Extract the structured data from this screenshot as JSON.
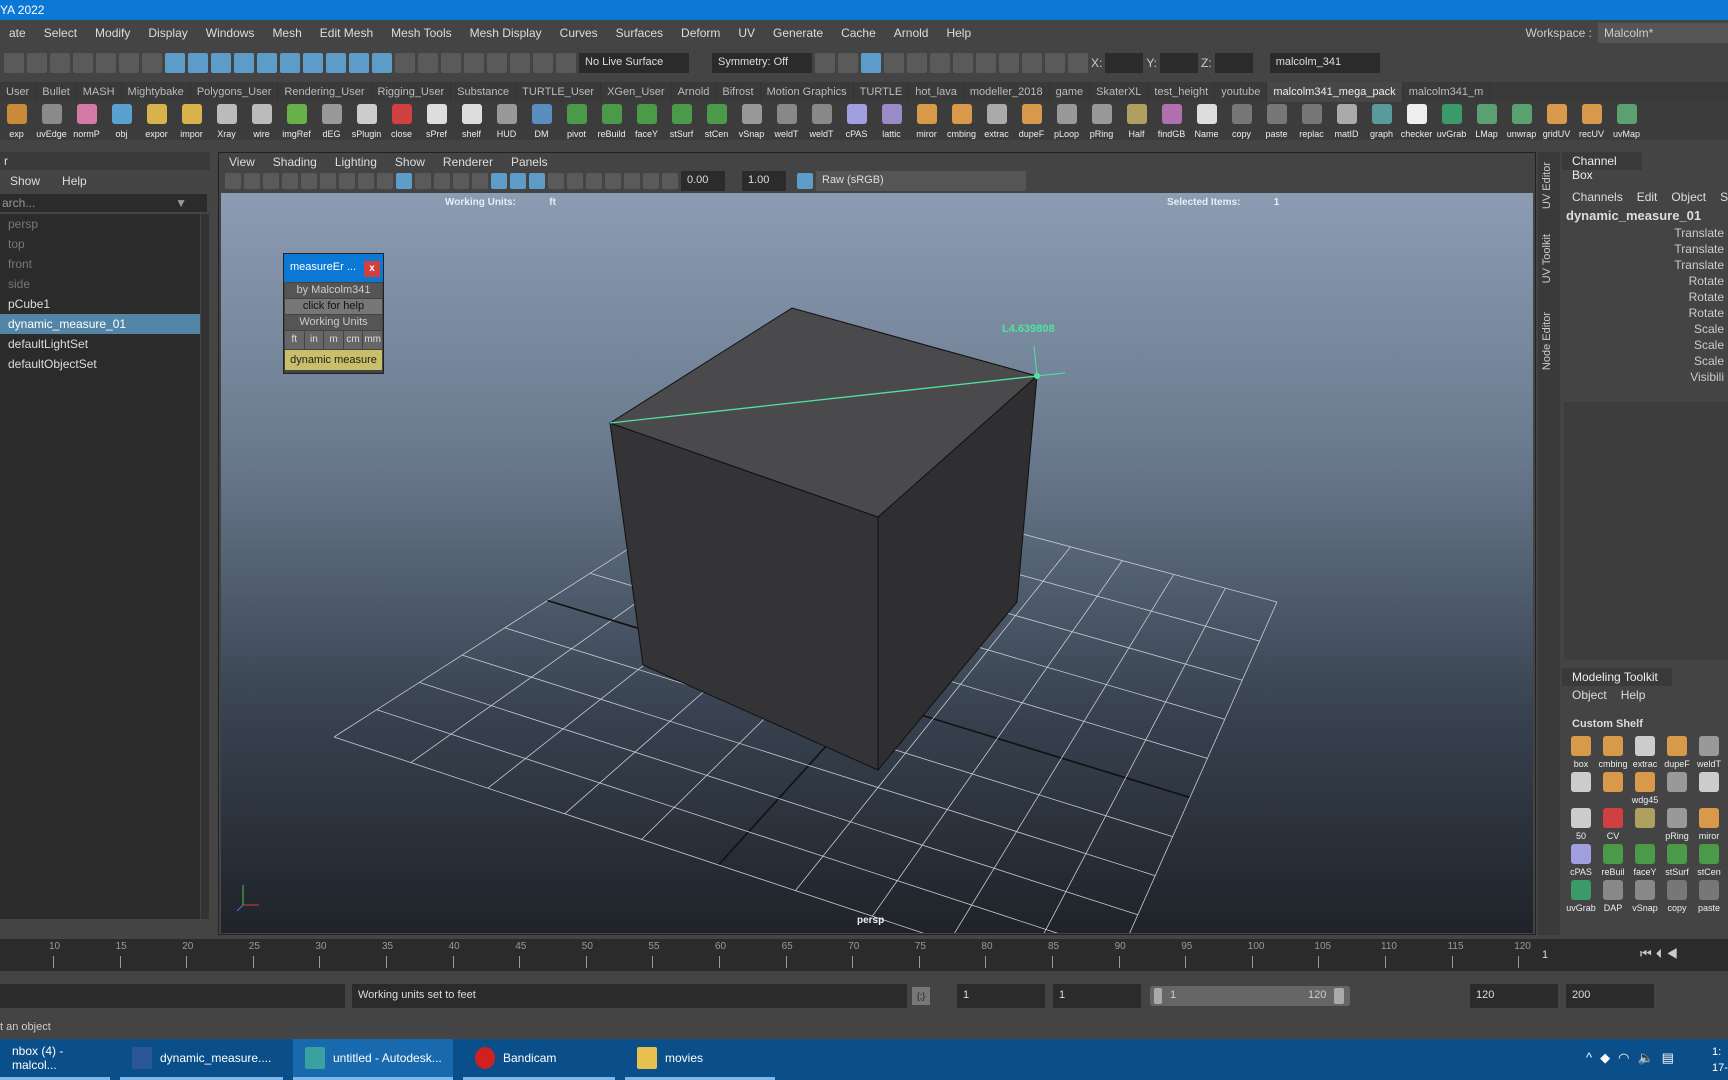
{
  "window": {
    "title": "YA 2022"
  },
  "menu": [
    "ate",
    "Select",
    "Modify",
    "Display",
    "Windows",
    "Mesh",
    "Edit Mesh",
    "Mesh Tools",
    "Mesh Display",
    "Curves",
    "Surfaces",
    "Deform",
    "UV",
    "Generate",
    "Cache",
    "Arnold",
    "Help"
  ],
  "workspace": {
    "label": "Workspace :",
    "value": "Malcolm*"
  },
  "statusline": {
    "live_surface": "No Live Surface",
    "symmetry": "Symmetry: Off",
    "x_label": "X:",
    "y_label": "Y:",
    "z_label": "Z:",
    "user": "malcolm_341"
  },
  "shelf_tabs": [
    "User",
    "Bullet",
    "MASH",
    "Mightybake",
    "Polygons_User",
    "Rendering_User",
    "Rigging_User",
    "Substance",
    "TURTLE_User",
    "XGen_User",
    "Arnold",
    "Bifrost",
    "Motion Graphics",
    "TURTLE",
    "hot_lava",
    "modeller_2018",
    "game",
    "SkaterXL",
    "test_height",
    "youtube",
    "malcolm341_mega_pack",
    "malcolm341_m"
  ],
  "active_shelf_tab": "malcolm341_mega_pack",
  "shelf": [
    "exp",
    "uvEdge",
    "normP",
    "obj",
    "expor",
    "impor",
    "Xray",
    "wire",
    "imgRef",
    "dEG",
    "sPlugin",
    "close",
    "sPref",
    "shelf",
    "HUD",
    "DM",
    "pivot",
    "reBuild",
    "faceY",
    "stSurf",
    "stCen",
    "vSnap",
    "weldT",
    "weldT",
    "cPAS",
    "lattic",
    "miror",
    "cmbing",
    "extrac",
    "dupeF",
    "pLoop",
    "pRing",
    "Half",
    "findGB",
    "Name",
    "copy",
    "paste",
    "replac",
    "matID",
    "graph",
    "checker",
    "uvGrab",
    "LMap",
    "unwrap",
    "gridUV",
    "recUV",
    "uvMap"
  ],
  "outliner": {
    "title": "r",
    "menu": [
      "Show",
      "Help"
    ],
    "search_placeholder": "arch...",
    "items": [
      {
        "label": "persp",
        "dim": true
      },
      {
        "label": "top",
        "dim": true
      },
      {
        "label": "front",
        "dim": true
      },
      {
        "label": "side",
        "dim": true
      },
      {
        "label": "pCube1"
      },
      {
        "label": "dynamic_measure_01",
        "selected": true
      },
      {
        "label": "defaultLightSet"
      },
      {
        "label": "defaultObjectSet"
      }
    ]
  },
  "panel": {
    "menu": [
      "View",
      "Shading",
      "Lighting",
      "Show",
      "Renderer",
      "Panels"
    ],
    "exposure": "0.00",
    "gamma": "1.00",
    "color_space": "Raw (sRGB)",
    "hud": {
      "units_label": "Working Units:",
      "units_value": "ft",
      "selected_label": "Selected Items:",
      "selected_value": "1",
      "camera": "persp"
    },
    "measure_label": "L4.639808"
  },
  "measure_window": {
    "title": "measureEr ...",
    "close": "x",
    "author": "by Malcolm341",
    "help": "click for help",
    "units_title": "Working Units",
    "units": [
      "ft",
      "in",
      "m",
      "cm",
      "mm"
    ],
    "action": "dynamic measure"
  },
  "side_tabs": [
    "UV Editor",
    "UV Toolkit",
    "Node Editor"
  ],
  "channel_box": {
    "tab": "Channel Box",
    "menu": [
      "Channels",
      "Edit",
      "Object",
      "Sh"
    ],
    "node": "dynamic_measure_01",
    "attrs": [
      "Translate",
      "Translate",
      "Translate",
      "Rotate",
      "Rotate",
      "Rotate",
      "Scale",
      "Scale",
      "Scale",
      "Visibili"
    ]
  },
  "modeling_toolkit": {
    "title": "Modeling Toolkit",
    "menu": [
      "Object",
      "Help"
    ],
    "shelf_title": "Custom Shelf",
    "icons": [
      "box",
      "cmbing",
      "extrac",
      "dupeF",
      "weldT",
      "",
      "",
      "wdg45",
      "",
      "",
      "50",
      "CV",
      "",
      "pRing",
      "miror",
      "cPAS",
      "reBuil",
      "faceY",
      "stSurf",
      "stCen",
      "uvGrab",
      "DAP",
      "vSnap",
      "copy",
      "paste"
    ]
  },
  "timeline": {
    "ticks": [
      10,
      15,
      20,
      25,
      30,
      35,
      40,
      45,
      50,
      55,
      60,
      65,
      70,
      75,
      80,
      85,
      90,
      95,
      100,
      105,
      110,
      115,
      120
    ],
    "current_frame": "1"
  },
  "range": {
    "command_feedback": "Working units set to feet",
    "start": "1",
    "anim_start": "1",
    "range_start": "1",
    "range_end": "120",
    "anim_end_field": "120",
    "end": "200"
  },
  "helpline": "t an object",
  "taskbar": [
    {
      "label": "nbox (4) - malcol..."
    },
    {
      "label": "dynamic_measure...."
    },
    {
      "label": "untitled - Autodesk...",
      "active": true
    },
    {
      "label": "Bandicam"
    },
    {
      "label": "movies"
    }
  ],
  "clock": {
    "time": "1:",
    "date": "17-"
  },
  "colors": {
    "accent": "#0a78d4",
    "selection": "#5285a6",
    "measure": "#4fe3a0",
    "measure_button": "#c9be6a"
  }
}
